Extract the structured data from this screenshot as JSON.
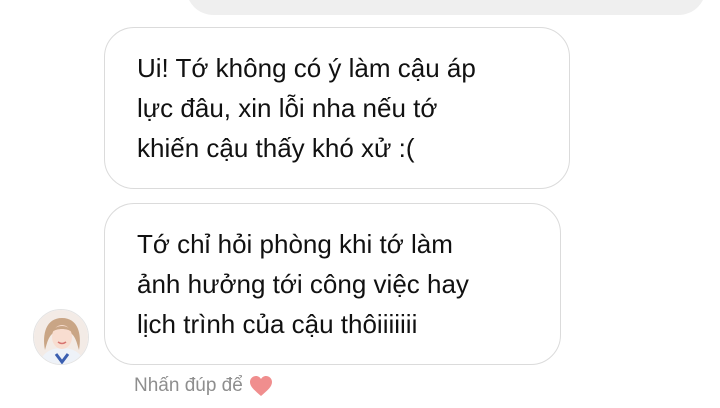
{
  "thread": {
    "messages": [
      {
        "lines": [
          "Ui! Tớ không có ý làm cậu áp",
          "lực đâu, xin lỗi nha nếu tớ",
          "khiến cậu thấy khó xử :("
        ]
      },
      {
        "lines": [
          "Tớ chỉ hỏi phòng khi tớ làm",
          "ảnh hưởng tới công việc hay",
          "lịch trình của cậu thôiiiiiii"
        ]
      }
    ],
    "reaction_hint": {
      "text": "Nhấn đúp để",
      "icon": "heart-icon",
      "icon_color": "#f08e8e"
    }
  },
  "colors": {
    "outgoing_bubble": "#efefef",
    "incoming_border": "#dbdbdb",
    "hint_text": "#8e8e8e"
  }
}
